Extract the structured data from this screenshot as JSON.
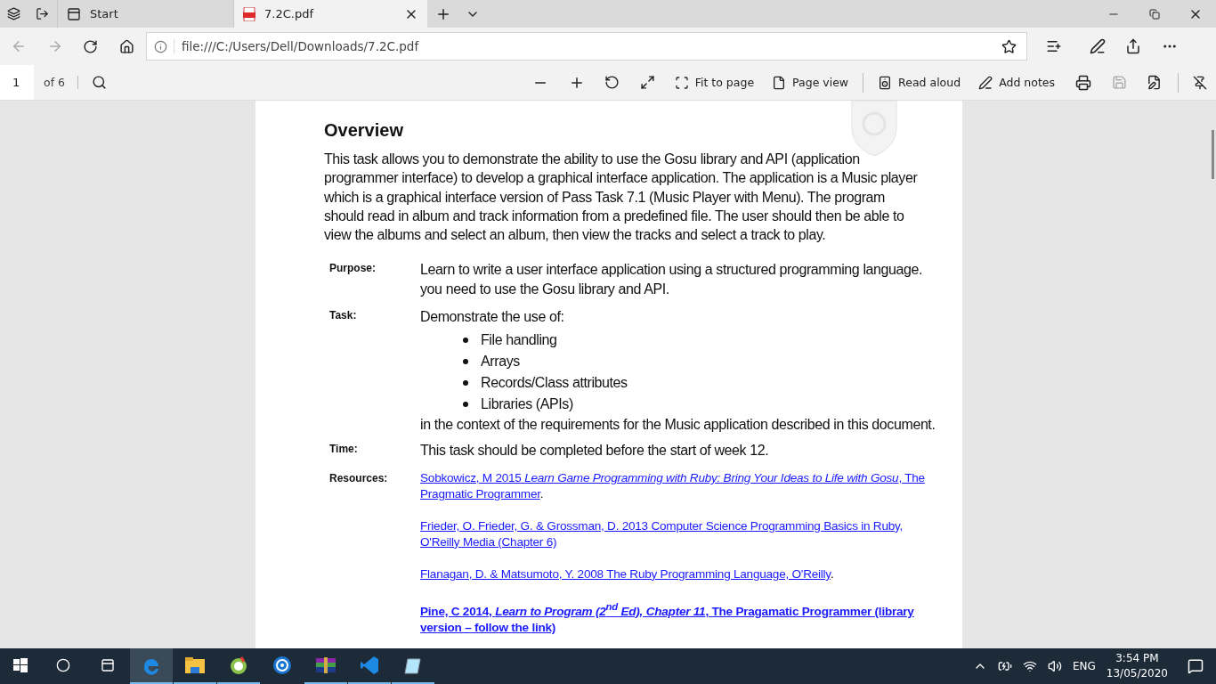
{
  "tabs": [
    {
      "label": "Start",
      "kind": "start",
      "selected": false
    },
    {
      "label": "7.2C.pdf",
      "kind": "pdf",
      "selected": true
    }
  ],
  "address": {
    "value": "file:///C:/Users/Dell/Downloads/7.2C.pdf"
  },
  "pdf_toolbar": {
    "page": "1",
    "page_count": "of 6",
    "tools": [
      {
        "label": "Fit to page",
        "kind": "fit"
      },
      {
        "label": "Page view",
        "kind": "pageview"
      },
      {
        "label": "Read aloud",
        "kind": "read"
      },
      {
        "label": "Add notes",
        "kind": "notes"
      }
    ]
  },
  "document": {
    "heading": "Overview",
    "intro": "This task allows you to demonstrate the ability to use the Gosu library and API (application programmer interface) to develop a graphical interface application.  The application is a Music player which is a graphical interface version of Pass Task 7.1 (Music Player with Menu). The program should read in album and track information from a predefined file. The user should then be able to view the albums and select an album, then view the tracks and select a track to play.",
    "rows": [
      {
        "label": "Purpose:",
        "kind": "text",
        "text": "Learn to write a user interface application using a structured programming language. you need to use the Gosu library and API."
      },
      {
        "label": "Task:",
        "kind": "list",
        "text": "Demonstrate the use of:",
        "bullets": [
          "File handling",
          "Arrays",
          "Records/Class attributes",
          "Libraries (APIs)"
        ],
        "after": "in the context of the requirements for the Music application described in this document."
      },
      {
        "label": "Time:",
        "kind": "text",
        "text": "This task should be completed before the start of week 12."
      },
      {
        "label": "Resources:",
        "kind": "links",
        "links": [
          {
            "text": "Sobkowicz, M 2015 *Learn Game Programming with Ruby: Bring Your Ideas to Life with Gosu*, The Pragmatic Programmer",
            "after": ".",
            "bold": false
          },
          {
            "text": "Frieder, O. Frieder, G. & Grossman, D. 2013 Computer Science Programming Basics in Ruby, O'Reilly Media (Chapter 6)",
            "bold": false
          },
          {
            "text": "Flanagan, D. & Matsumoto, Y. 2008 The Ruby Programming Language, O'Reilly",
            "after": ".",
            "bold": false
          },
          {
            "text": "Pine, C 2014, *Learn to Program (2$^{nd}$ Ed), Chapter 11*, The Pragamatic Programmer (library version – follow the link)",
            "bold": true
          }
        ]
      }
    ]
  },
  "taskbar": {
    "apps": [
      {
        "kind": "edge",
        "running": true,
        "active": true
      },
      {
        "kind": "folder",
        "running": true,
        "active": false
      },
      {
        "kind": "greenapp",
        "running": true,
        "active": false
      },
      {
        "kind": "blueapp",
        "running": false,
        "active": false
      },
      {
        "kind": "archive",
        "running": true,
        "active": false
      },
      {
        "kind": "code",
        "running": true,
        "active": false
      },
      {
        "kind": "notepad",
        "running": true,
        "active": false
      }
    ],
    "language": "ENG",
    "time": "3:54 PM",
    "date": "13/05/2020"
  }
}
